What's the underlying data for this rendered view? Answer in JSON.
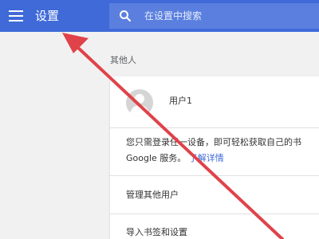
{
  "header": {
    "title": "设置",
    "menu_icon": "hamburger-menu-icon",
    "search_icon": "search-icon",
    "search_placeholder": "在设置中搜索"
  },
  "section": {
    "title": "其他人"
  },
  "user": {
    "name": "用户1",
    "avatar_icon": "person-icon"
  },
  "sync": {
    "line1": "您只需登录任一设备，即可轻松获取自己的书",
    "line2_prefix": "Google 服务。",
    "learn_more": "了解详情"
  },
  "actions": {
    "manage_users": "管理其他用户",
    "import_bookmarks": "导入书签和设置"
  },
  "colors": {
    "header": "#3f6ad8",
    "annotation_arrow": "#e0424a"
  }
}
